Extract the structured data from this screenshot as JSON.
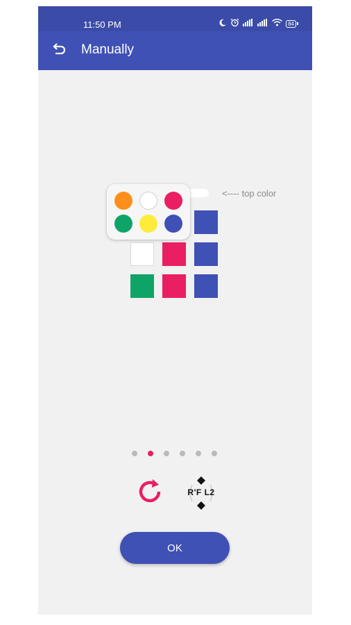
{
  "status_bar": {
    "time": "11:50 PM",
    "icons": [
      "moon-icon",
      "alarm-icon",
      "signal-icon",
      "signal-icon",
      "wifi-icon",
      "battery-icon"
    ],
    "battery_text": "84"
  },
  "app_bar": {
    "title": "Manually",
    "back_icon": "undo-arrow-icon"
  },
  "grid": {
    "hint_text": "<---- top color",
    "cell_colors": [
      [
        "#ffffff",
        "#ffffff",
        "#3f51b5"
      ],
      [
        "#ffffff",
        "#e91e63",
        "#3f51b5"
      ],
      [
        "#0fa467",
        "#e91e63",
        "#3f51b5"
      ]
    ]
  },
  "palette": {
    "colors": [
      "#ff8f1c",
      "#ffffff",
      "#e91e63",
      "#0fa467",
      "#ffeb3b",
      "#3f51b5"
    ]
  },
  "pager": {
    "count": 6,
    "active_index": 1
  },
  "actions": {
    "refresh_icon": "refresh-icon",
    "notation_text": "R'F L2"
  },
  "ok_button": {
    "label": "OK"
  },
  "colors": {
    "primary": "#3f51b5",
    "accent": "#e91e63",
    "background": "#f1f1f1"
  }
}
